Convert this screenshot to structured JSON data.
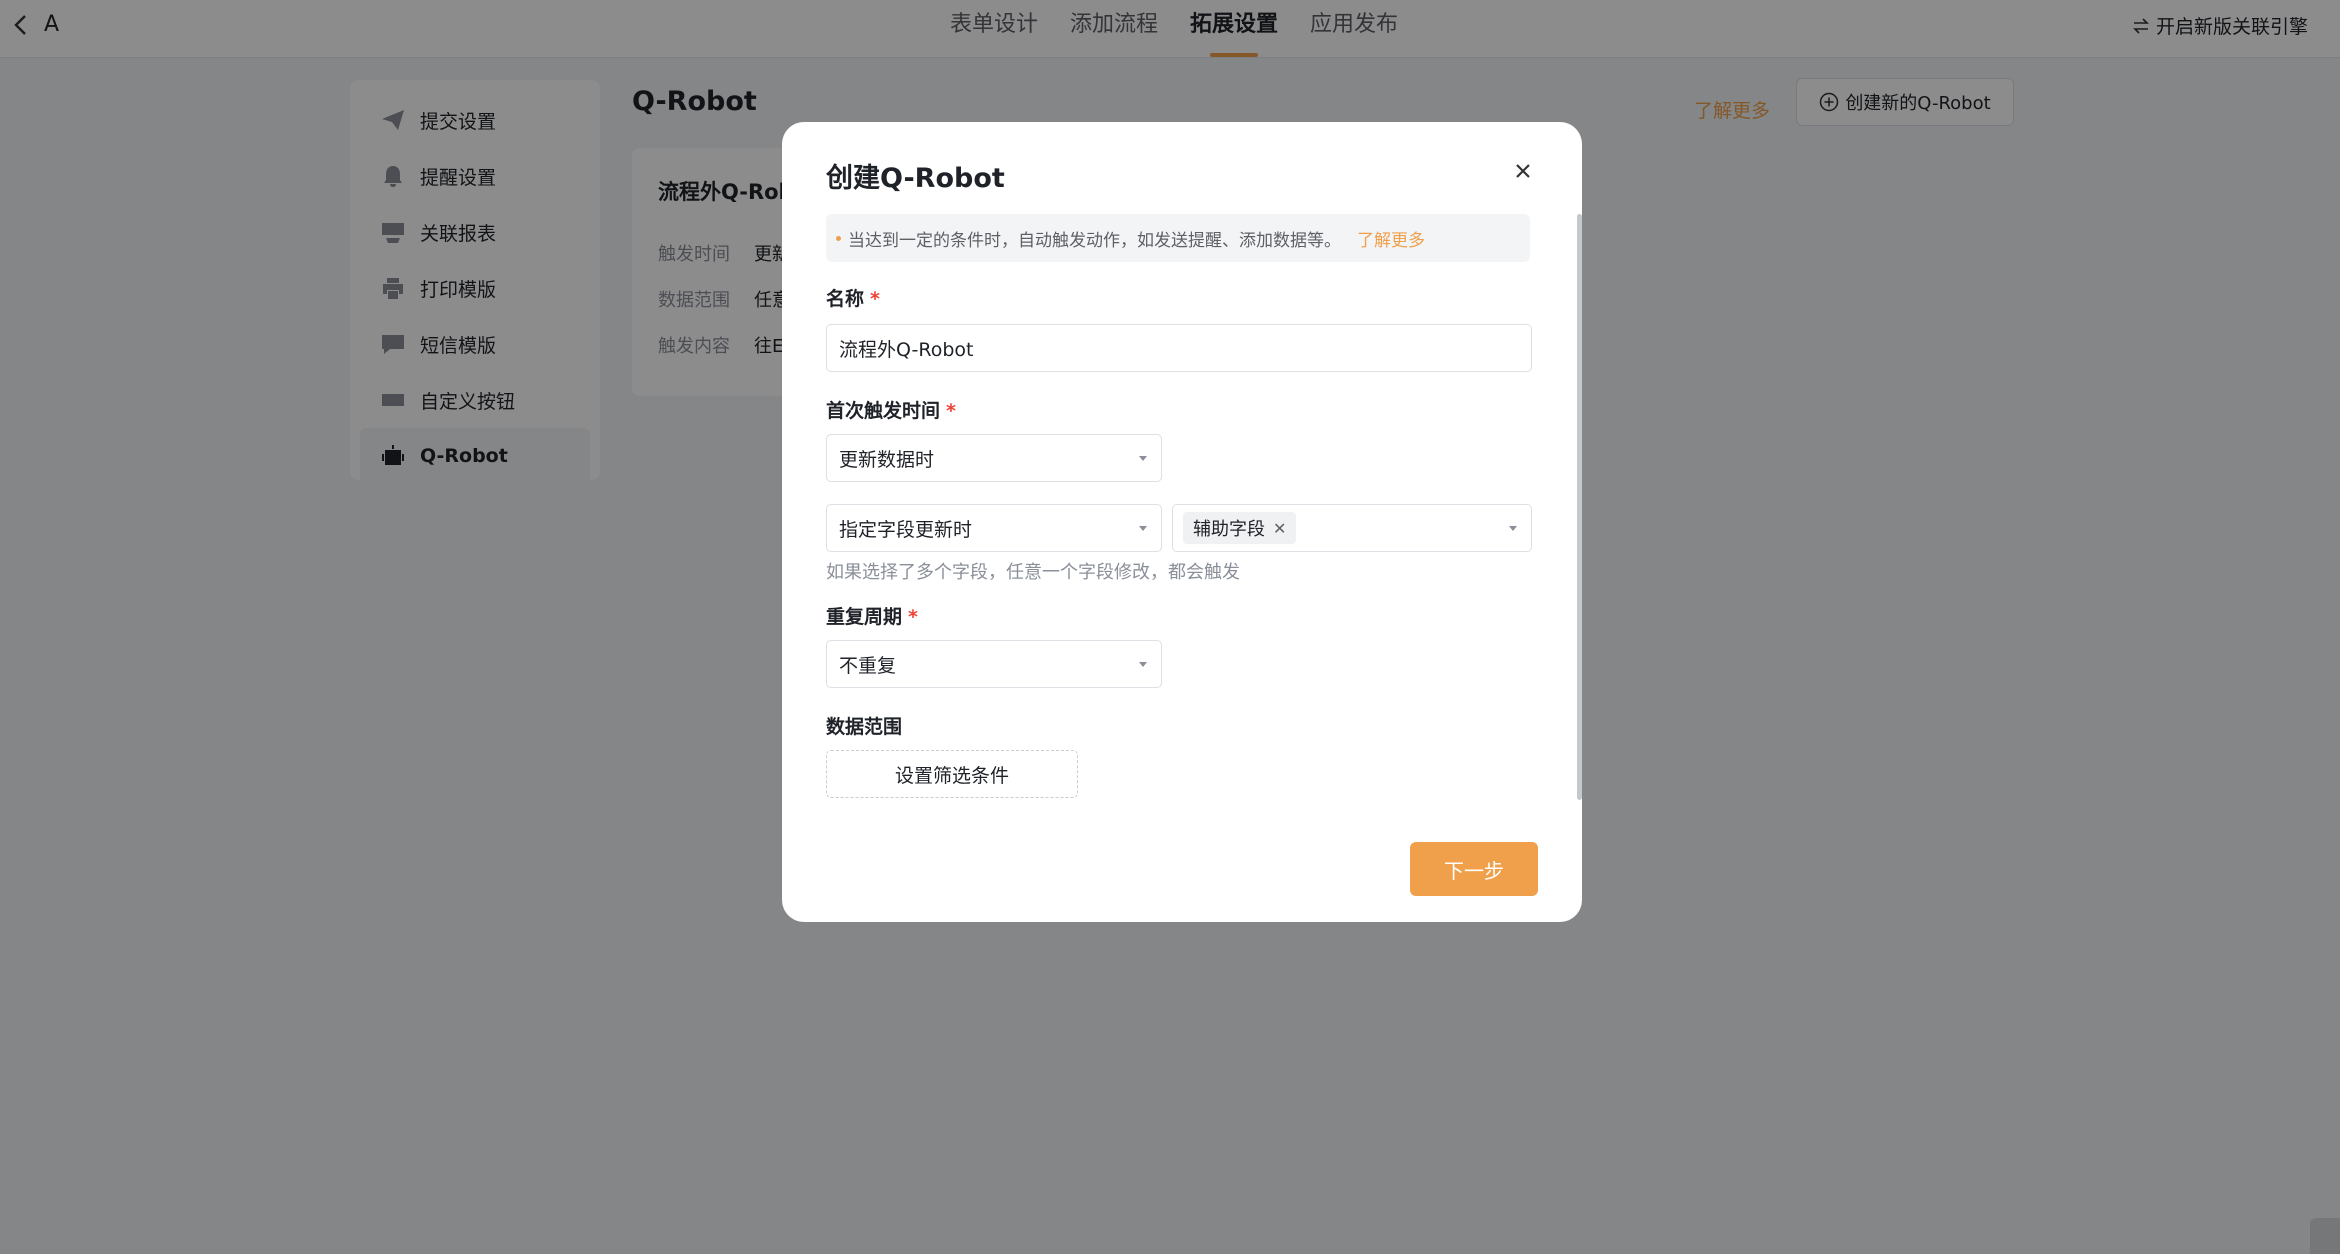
{
  "topbar": {
    "back_icon": "chevron-left-icon",
    "app_name": "A",
    "tabs": [
      "表单设计",
      "添加流程",
      "拓展设置",
      "应用发布"
    ],
    "active_tab": 2,
    "engine_label": "开启新版关联引擎"
  },
  "sidebar": {
    "items": [
      {
        "label": "提交设置",
        "icon": "send-icon"
      },
      {
        "label": "提醒设置",
        "icon": "bell-icon"
      },
      {
        "label": "关联报表",
        "icon": "report-icon"
      },
      {
        "label": "打印模版",
        "icon": "printer-icon"
      },
      {
        "label": "短信模版",
        "icon": "message-icon"
      },
      {
        "label": "自定义按钮",
        "icon": "button-icon"
      },
      {
        "label": "Q-Robot",
        "icon": "robot-icon"
      }
    ],
    "active_index": 6
  },
  "main": {
    "title": "Q-Robot",
    "learn_more": "了解更多",
    "create_button": "创建新的Q-Robot",
    "card": {
      "title": "流程外Q-Rob",
      "rows": [
        {
          "key": "触发时间",
          "value": "更新"
        },
        {
          "key": "数据范围",
          "value": "任意"
        },
        {
          "key": "触发内容",
          "value": "往E"
        }
      ]
    }
  },
  "modal": {
    "title": "创建Q-Robot",
    "notice": "当达到一定的条件时，自动触发动作，如发送提醒、添加数据等。",
    "notice_link": "了解更多",
    "name_label": "名称",
    "name_value": "流程外Q-Robot",
    "first_trigger_label": "首次触发时间",
    "first_trigger_value": "更新数据时",
    "field_trigger_value": "指定字段更新时",
    "field_tag": "辅助字段",
    "hint": "如果选择了多个字段，任意一个字段修改，都会触发",
    "repeat_label": "重复周期",
    "repeat_value": "不重复",
    "data_range_label": "数据范围",
    "filter_button": "设置筛选条件",
    "next_button": "下一步"
  },
  "colors": {
    "accent": "#f0a04b",
    "required": "#f04134"
  }
}
